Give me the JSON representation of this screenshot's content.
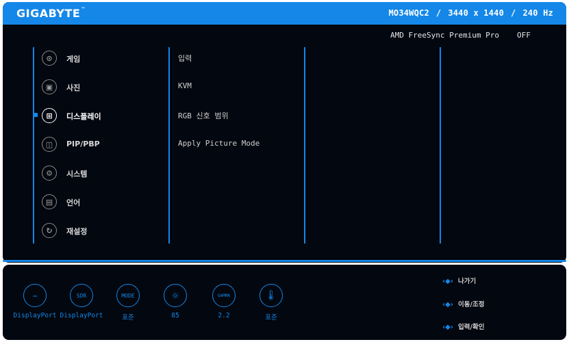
{
  "header": {
    "logo": "GIGABYTE",
    "logo_mark": "™",
    "model": "MO34WQC2",
    "resolution": "3440 x 1440",
    "refresh": "240 Hz",
    "separator": "/"
  },
  "status": {
    "freesync_label": "AMD FreeSync Premium Pro",
    "freesync_value": "OFF"
  },
  "menu": {
    "items": [
      {
        "label": "게임",
        "icon": "gamepad-icon"
      },
      {
        "label": "사진",
        "icon": "picture-icon"
      },
      {
        "label": "디스플레이",
        "icon": "display-icon"
      },
      {
        "label": "PIP/PBP",
        "icon": "pip-icon"
      },
      {
        "label": "시스템",
        "icon": "gear-icon"
      },
      {
        "label": "언어",
        "icon": "save-icon"
      },
      {
        "label": "재설정",
        "icon": "reset-icon"
      }
    ],
    "active_index": 2
  },
  "submenu": {
    "items": [
      "입력",
      "KVM",
      "RGB 신호 범위",
      "Apply Picture Mode"
    ]
  },
  "footer": {
    "stats": [
      {
        "icon_text": "▭",
        "icon": "input-port-icon",
        "value": "DisplayPort"
      },
      {
        "icon_text": "SDR",
        "icon": "sdr-icon",
        "value": "DisplayPort"
      },
      {
        "icon_text": "MODE",
        "icon": "mode-icon",
        "value": "표준"
      },
      {
        "icon_text": "☼",
        "icon": "brightness-icon",
        "value": "85"
      },
      {
        "icon_text": "GAMMA",
        "icon": "gamma-icon",
        "value": "2.2"
      },
      {
        "icon_text": "🌡",
        "icon": "temperature-icon",
        "value": "표준"
      }
    ],
    "hints": [
      {
        "label": "나가기",
        "icon": "joystick-icon"
      },
      {
        "label": "이동/조정",
        "icon": "joystick-icon"
      },
      {
        "label": "입력/확인",
        "icon": "joystick-icon"
      }
    ]
  },
  "colors": {
    "accent": "#1487e8",
    "background": "#03070f"
  }
}
